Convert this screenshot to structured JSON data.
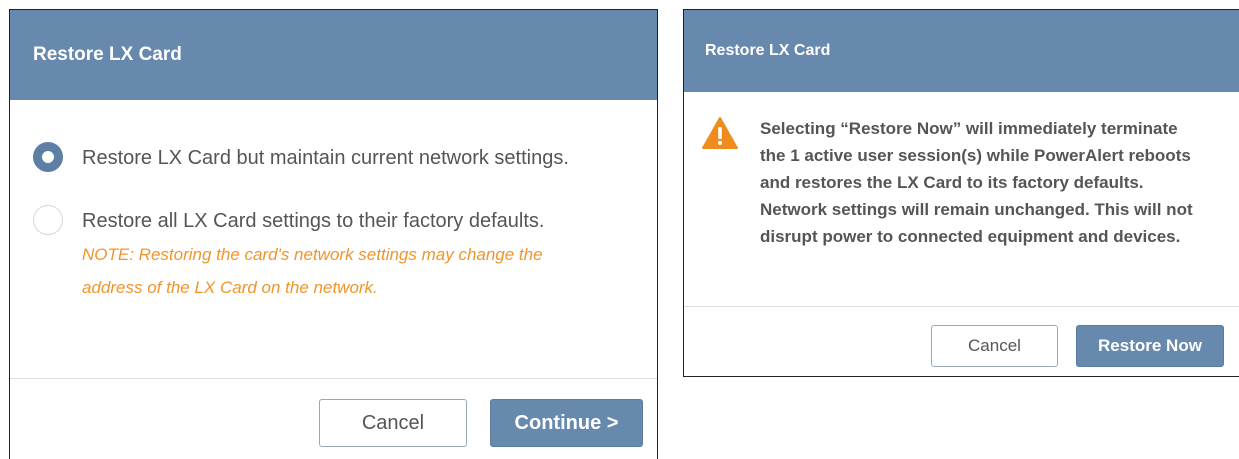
{
  "dialog_restore_options": {
    "title": "Restore LX Card",
    "options": [
      {
        "label": "Restore LX Card but maintain current network settings.",
        "selected": true
      },
      {
        "label": "Restore all LX Card settings to their factory defaults.",
        "selected": false
      }
    ],
    "note_line1": "NOTE: Restoring the card's network settings may change the",
    "note_line2": "address of the LX Card on the network.",
    "cancel_label": "Cancel",
    "continue_label": "Continue >"
  },
  "dialog_restore_confirm": {
    "title": "Restore LX Card",
    "warning_icon": "warning-triangle-icon",
    "message_lines": [
      "Selecting “Restore Now” will immediately terminate",
      "the 1 active user session(s) while PowerAlert reboots",
      "and restores the LX Card to its factory defaults.",
      "Network settings will remain unchanged. This will not",
      "disrupt power to connected equipment and devices."
    ],
    "cancel_label": "Cancel",
    "restore_label": "Restore Now"
  },
  "colors": {
    "header_bg": "#6689ad",
    "primary_button": "#6689ad",
    "note_text": "#f0952a",
    "warning_icon": "#f08c1e"
  }
}
